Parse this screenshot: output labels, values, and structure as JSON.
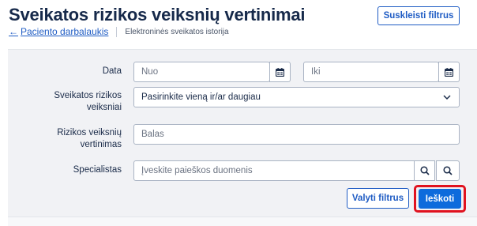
{
  "header": {
    "title": "Sveikatos rizikos veiksnių vertinimai",
    "back_link": "Paciento darbalaukis",
    "back_arrow": "←",
    "subtitle": "Elektroninės sveikatos istorija",
    "collapse_button": "Suskleisti filtrus"
  },
  "filters": {
    "date": {
      "label": "Data",
      "from_placeholder": "Nuo",
      "to_placeholder": "Iki",
      "icon": "calendar-icon"
    },
    "risk_factors": {
      "label_line1": "Sveikatos rizikos",
      "label_line2": "veiksniai",
      "value": "Pasirinkite vieną ir/ar daugiau",
      "icon": "chevron-down-icon"
    },
    "risk_score": {
      "label_line1": "Rizikos veiksnių",
      "label_line2": "vertinimas",
      "placeholder": "Balas"
    },
    "specialist": {
      "label": "Specialistas",
      "placeholder": "Įveskite paieškos duomenis",
      "icon": "search-icon"
    }
  },
  "actions": {
    "reset": "Valyti filtrus",
    "search": "Ieškoti"
  },
  "colors": {
    "primary": "#0d6bdc",
    "link": "#1f5cc4",
    "highlight": "#e0121f",
    "panel_bg": "#f1f2f5"
  }
}
